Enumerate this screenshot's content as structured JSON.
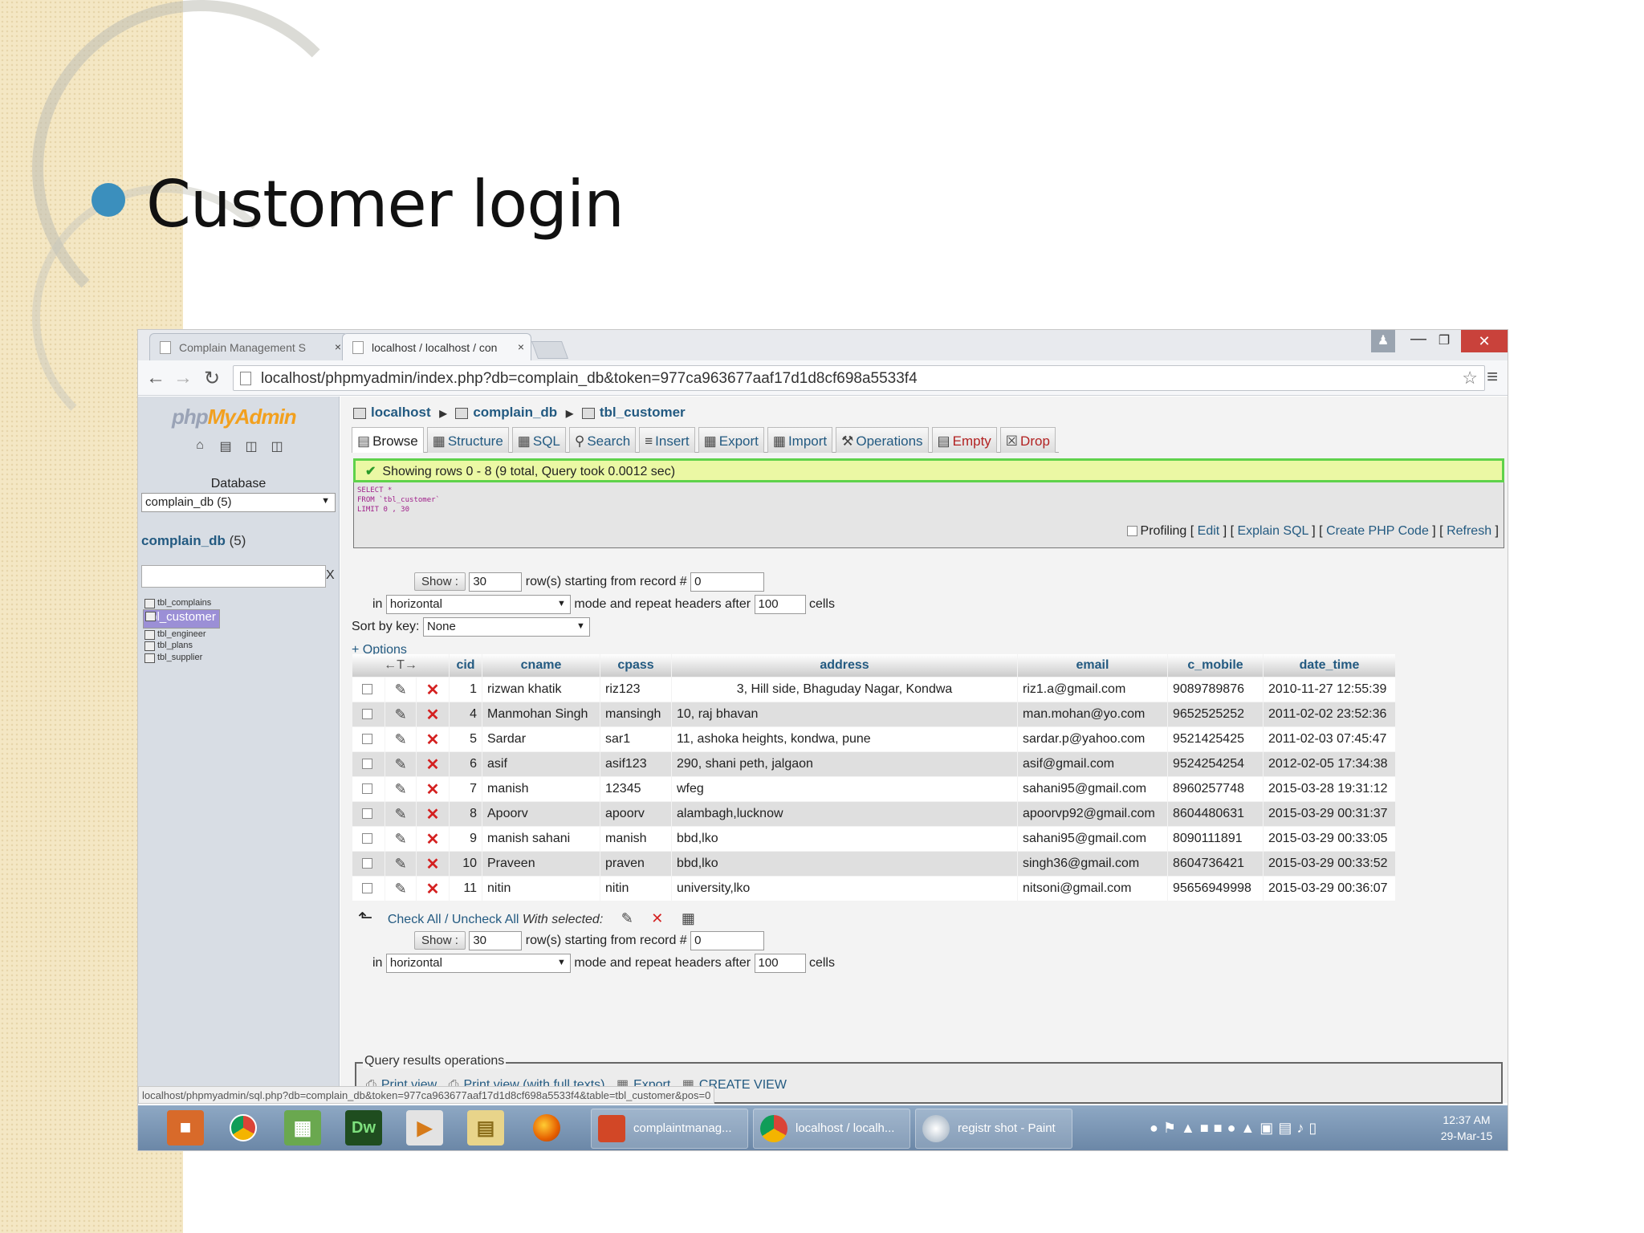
{
  "slide": {
    "title": "Customer login"
  },
  "browser": {
    "tabs": [
      {
        "label": "Complain Management S",
        "close": "×"
      },
      {
        "label": "localhost / localhost / con",
        "close": "×"
      }
    ],
    "url": "localhost/phpmyadmin/index.php?db=complain_db&token=977ca963677aaf17d1d8cf698a5533f4",
    "status_url": "localhost/phpmyadmin/sql.php?db=complain_db&token=977ca963677aaf17d1d8cf698a5533f4&table=tbl_customer&pos=0"
  },
  "sidebar": {
    "logo_php": "php",
    "logo_myadmin": "MyAdmin",
    "database_label": "Database",
    "database_selected": "complain_db (5)",
    "db_link": "complain_db",
    "db_count": "(5)",
    "filter_clear": "X",
    "tables": [
      "tbl_complains",
      "tbl_customer",
      "tbl_engineer",
      "tbl_plans",
      "tbl_supplier"
    ]
  },
  "breadcrumb": {
    "server": "localhost",
    "db": "complain_db",
    "table": "tbl_customer"
  },
  "tabs": {
    "browse": "Browse",
    "structure": "Structure",
    "sql": "SQL",
    "search": "Search",
    "insert": "Insert",
    "export": "Export",
    "import": "Import",
    "operations": "Operations",
    "empty": "Empty",
    "drop": "Drop"
  },
  "query": {
    "success": "Showing rows 0 - 8 (9 total, Query took 0.0012 sec)",
    "sql_text": "SELECT *\nFROM `tbl_customer`\nLIMIT 0 , 30",
    "profiling": "Profiling",
    "edit": "Edit",
    "explain": "Explain SQL",
    "php": "Create PHP Code",
    "refresh": "Refresh"
  },
  "nav": {
    "show_btn": "Show :",
    "rows": "30",
    "rows_text": "row(s) starting from record #",
    "start": "0",
    "in_text": "in",
    "mode": "horizontal",
    "repeat_text": "mode and repeat headers after",
    "repeat": "100",
    "cells_text": "cells",
    "sort_label": "Sort by key:",
    "sort_value": "None",
    "options": "+ Options"
  },
  "table": {
    "columns": [
      "cid",
      "cname",
      "cpass",
      "address",
      "email",
      "c_mobile",
      "date_time"
    ],
    "rows": [
      [
        "1",
        "rizwan khatik",
        "riz123",
        "3, Hill side, Bhaguday Nagar, Kondwa",
        "riz1.a@gmail.com",
        "9089789876",
        "2010-11-27 12:55:39"
      ],
      [
        "4",
        "Manmohan Singh",
        "mansingh",
        "10, raj bhavan",
        "man.mohan@yo.com",
        "9652525252",
        "2011-02-02 23:52:36"
      ],
      [
        "5",
        "Sardar",
        "sar1",
        "11, ashoka heights, kondwa, pune",
        "sardar.p@yahoo.com",
        "9521425425",
        "2011-02-03 07:45:47"
      ],
      [
        "6",
        "asif",
        "asif123",
        "290, shani peth, jalgaon",
        "asif@gmail.com",
        "9524254254",
        "2012-02-05 17:34:38"
      ],
      [
        "7",
        "manish",
        "12345",
        "wfeg",
        "sahani95@gmail.com",
        "8960257748",
        "2015-03-28 19:31:12"
      ],
      [
        "8",
        "Apoorv",
        "apoorv",
        "alambagh,lucknow",
        "apoorvp92@gmail.com",
        "8604480631",
        "2015-03-29 00:31:37"
      ],
      [
        "9",
        "manish sahani",
        "manish",
        "bbd,lko",
        "sahani95@gmail.com",
        "8090111891",
        "2015-03-29 00:33:05"
      ],
      [
        "10",
        "Praveen",
        "praven",
        "bbd,lko",
        "singh36@gmail.com",
        "8604736421",
        "2015-03-29 00:33:52"
      ],
      [
        "11",
        "nitin",
        "nitin",
        "university,lko",
        "nitsoni@gmail.com",
        "95656949998",
        "2015-03-29 00:36:07"
      ]
    ]
  },
  "bulk": {
    "check_all": "Check All / Uncheck All",
    "with_selected": "With selected:"
  },
  "qro": {
    "legend": "Query results operations",
    "print": "Print view",
    "print_full": "Print view (with full texts)",
    "export": "Export",
    "create_view": "CREATE VIEW"
  },
  "taskbar": {
    "windows": [
      "complaintmanag...",
      "localhost / localh...",
      "registr shot - Paint"
    ],
    "dw_label": "Dw",
    "time": "12:37 AM",
    "date": "29-Mar-15"
  },
  "colors": {
    "accent_link": "#235a81",
    "success_border": "#5fd24b",
    "close_red": "#c9423b",
    "bullet": "#3b8fbd"
  }
}
